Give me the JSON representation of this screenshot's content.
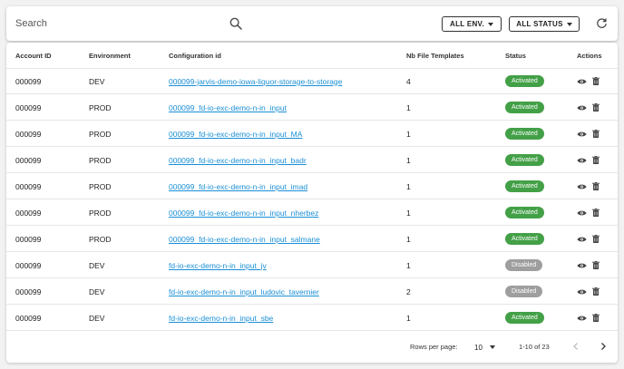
{
  "toolbar": {
    "search_placeholder": "Search",
    "env_filter_label": "ALL ENV.",
    "status_filter_label": "ALL STATUS"
  },
  "table": {
    "headers": {
      "account_id": "Account ID",
      "environment": "Environment",
      "configuration_id": "Configuration id",
      "nb_file_templates": "Nb File Templates",
      "status": "Status",
      "actions": "Actions"
    },
    "rows": [
      {
        "account_id": "000099",
        "environment": "DEV",
        "configuration_id": "000099-jarvis-demo-iowa-liquor-storage-to-storage",
        "nb_file_templates": "4",
        "status": "Activated"
      },
      {
        "account_id": "000099",
        "environment": "PROD",
        "configuration_id": "000099_fd-io-exc-demo-n-in_input",
        "nb_file_templates": "1",
        "status": "Activated"
      },
      {
        "account_id": "000099",
        "environment": "PROD",
        "configuration_id": "000099_fd-io-exc-demo-n-in_input_MA",
        "nb_file_templates": "1",
        "status": "Activated"
      },
      {
        "account_id": "000099",
        "environment": "PROD",
        "configuration_id": "000099_fd-io-exc-demo-n-in_input_badr",
        "nb_file_templates": "1",
        "status": "Activated"
      },
      {
        "account_id": "000099",
        "environment": "PROD",
        "configuration_id": "000099_fd-io-exc-demo-n-in_input_imad",
        "nb_file_templates": "1",
        "status": "Activated"
      },
      {
        "account_id": "000099",
        "environment": "PROD",
        "configuration_id": "000099_fd-io-exc-demo-n-in_input_nherbez",
        "nb_file_templates": "1",
        "status": "Activated"
      },
      {
        "account_id": "000099",
        "environment": "PROD",
        "configuration_id": "000099_fd-io-exc-demo-n-in_input_salmane",
        "nb_file_templates": "1",
        "status": "Activated"
      },
      {
        "account_id": "000099",
        "environment": "DEV",
        "configuration_id": "fd-io-exc-demo-n-in_input_jv",
        "nb_file_templates": "1",
        "status": "Disabled"
      },
      {
        "account_id": "000099",
        "environment": "DEV",
        "configuration_id": "fd-io-exc-demo-n-in_input_ludovic_tavernier",
        "nb_file_templates": "2",
        "status": "Disabled"
      },
      {
        "account_id": "000099",
        "environment": "DEV",
        "configuration_id": "fd-io-exc-demo-n-in_input_sbe",
        "nb_file_templates": "1",
        "status": "Activated"
      }
    ]
  },
  "pagination": {
    "rows_per_page_label": "Rows per page:",
    "rows_per_page_value": "10",
    "range_text": "1-10 of 23"
  },
  "colors": {
    "activated": "#43a047",
    "disabled": "#9e9e9e",
    "link": "#1a8fd6"
  },
  "icons": [
    "search-icon",
    "chevron-down-icon",
    "refresh-icon",
    "eye-icon",
    "trash-icon",
    "chevron-left-icon",
    "chevron-right-icon"
  ]
}
